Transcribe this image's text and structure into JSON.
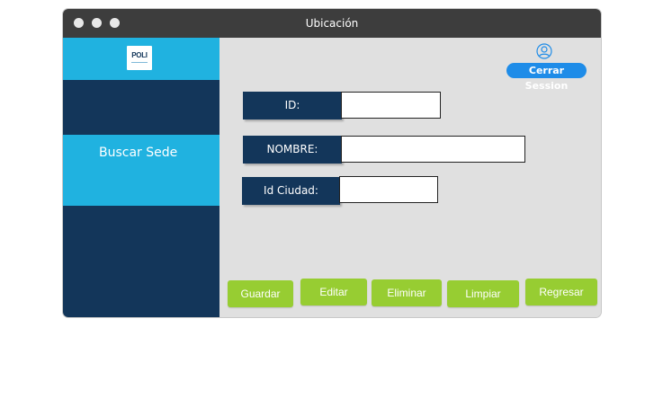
{
  "window": {
    "title": "Ubicación"
  },
  "sidebar": {
    "logo_text": "POLI",
    "items": [
      {
        "label": "Buscar Sede"
      }
    ]
  },
  "header": {
    "logout_label": "Cerrar Session"
  },
  "form": {
    "id_label": "ID:",
    "id_value": "",
    "nombre_label": "NOMBRE:",
    "nombre_value": "",
    "ciudad_label": "Id Ciudad:",
    "ciudad_value": ""
  },
  "buttons": {
    "guardar": "Guardar",
    "editar": "Editar",
    "eliminar": "Eliminar",
    "limpiar": "Limpiar",
    "regresar": "Regresar"
  },
  "colors": {
    "sidebar": "#13365a",
    "accent_blue": "#20b2e0",
    "button_green": "#97cd32",
    "logout_blue": "#1e8ce8",
    "titlebar": "#3d3d3d"
  },
  "icons": {
    "user": "user-circle-icon"
  }
}
